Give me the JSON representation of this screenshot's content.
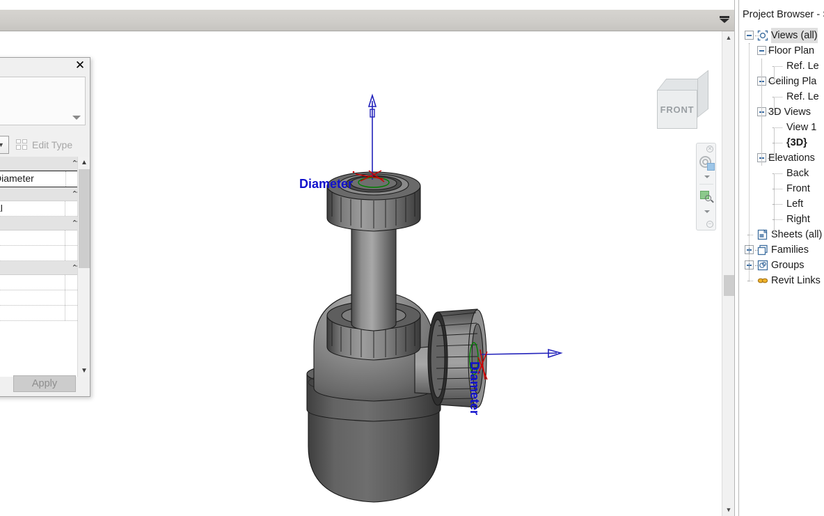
{
  "window": {
    "canvas_background": "#ffffff",
    "accent_blue": "#1111cc"
  },
  "topbar": {
    "dropdown_icon": "options-dropdown-icon"
  },
  "properties_palette": {
    "close_label": "✕",
    "close_icon": "close-icon",
    "type_dropdown_icon": "chevron-down-icon",
    "type_combo_icon": "chevron-down-icon",
    "edit_type_label": "Edit Type",
    "edit_type_icon": "edit-type-icon",
    "apply_label": "Apply",
    "sections": [
      {
        "collapse_icon": "collapse-chevrons-icon"
      },
      {
        "collapse_icon": "collapse-chevrons-icon"
      },
      {
        "collapse_icon": "collapse-chevrons-icon"
      },
      {
        "collapse_icon": "collapse-chevrons-icon"
      }
    ],
    "rows": [
      {
        "value": "Diameter",
        "selected": true
      },
      {
        "value": "al",
        "selected": false
      },
      {
        "value": "",
        "selected": false
      },
      {
        "value": "",
        "selected": false
      },
      {
        "value": "",
        "selected": false
      },
      {
        "value": "",
        "selected": false
      },
      {
        "value": "",
        "selected": false
      }
    ],
    "scroll_up_icon": "scroll-up-icon",
    "scroll_down_icon": "scroll-down-icon"
  },
  "viewcube": {
    "face_label": "FRONT",
    "name": "view-cube"
  },
  "navbar": {
    "close_icon": "close-circle-icon",
    "steering_wheel_icon": "steering-wheel-icon",
    "wheel_caret_icon": "chevron-down-icon",
    "zoom_icon": "zoom-region-icon",
    "zoom_caret_icon": "chevron-down-icon",
    "minimize_icon": "minimize-circle-icon"
  },
  "canvas_scrollbar": {
    "up_icon": "scroll-up-icon",
    "down_icon": "scroll-down-icon"
  },
  "model_annotations": {
    "top_connector_label": "Diameter",
    "right_connector_label": "Diameter",
    "arrow_color": "#2222bb",
    "connector_ring_color": "#008000",
    "connector_cross_color": "#d00000"
  },
  "project_browser": {
    "title": "Project Browser - S",
    "tree": [
      {
        "label": "Views (all)",
        "depth": 0,
        "toggle": "minus",
        "icon": "views-icon",
        "selected": true,
        "bold": false
      },
      {
        "label": "Floor Plan",
        "depth": 1,
        "toggle": "minus",
        "icon": null,
        "selected": false,
        "bold": false
      },
      {
        "label": "Ref. Le",
        "depth": 2,
        "toggle": null,
        "icon": null,
        "selected": false,
        "bold": false
      },
      {
        "label": "Ceiling Pla",
        "depth": 1,
        "toggle": "minus",
        "icon": null,
        "selected": false,
        "bold": false
      },
      {
        "label": "Ref. Le",
        "depth": 2,
        "toggle": null,
        "icon": null,
        "selected": false,
        "bold": false
      },
      {
        "label": "3D Views",
        "depth": 1,
        "toggle": "minus",
        "icon": null,
        "selected": false,
        "bold": false
      },
      {
        "label": "View 1",
        "depth": 2,
        "toggle": null,
        "icon": null,
        "selected": false,
        "bold": false
      },
      {
        "label": "{3D}",
        "depth": 2,
        "toggle": null,
        "icon": null,
        "selected": false,
        "bold": true
      },
      {
        "label": "Elevations",
        "depth": 1,
        "toggle": "minus",
        "icon": null,
        "selected": false,
        "bold": false
      },
      {
        "label": "Back",
        "depth": 2,
        "toggle": null,
        "icon": null,
        "selected": false,
        "bold": false
      },
      {
        "label": "Front",
        "depth": 2,
        "toggle": null,
        "icon": null,
        "selected": false,
        "bold": false
      },
      {
        "label": "Left",
        "depth": 2,
        "toggle": null,
        "icon": null,
        "selected": false,
        "bold": false
      },
      {
        "label": "Right",
        "depth": 2,
        "toggle": null,
        "icon": null,
        "selected": false,
        "bold": false
      },
      {
        "label": "Sheets (all)",
        "depth": 0,
        "toggle": null,
        "icon": "sheets-icon",
        "selected": false,
        "bold": false
      },
      {
        "label": "Families",
        "depth": 0,
        "toggle": "plus",
        "icon": "families-icon",
        "selected": false,
        "bold": false
      },
      {
        "label": "Groups",
        "depth": 0,
        "toggle": "plus",
        "icon": "groups-icon",
        "selected": false,
        "bold": false
      },
      {
        "label": "Revit Links",
        "depth": 0,
        "toggle": null,
        "icon": "revit-links-icon",
        "selected": false,
        "bold": false
      }
    ]
  }
}
